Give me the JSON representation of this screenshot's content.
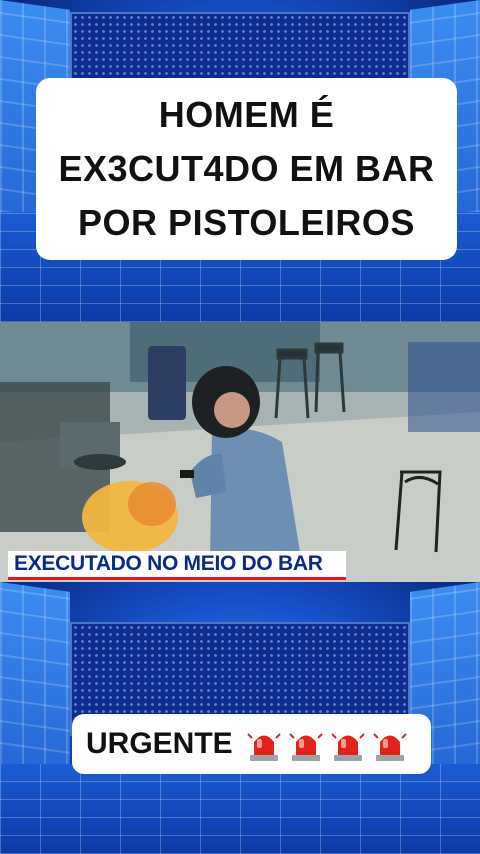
{
  "headline": {
    "lines": [
      "HOMEM É",
      "EX3CUT4DO EM BAR",
      "POR PISTOLEIROS"
    ]
  },
  "video": {
    "lower_third": "EXECUTADO NO MEIO DO BAR"
  },
  "footer": {
    "urgent_label": "URGENTE",
    "siren_icon": "police-siren-emoji",
    "siren_count": 4
  },
  "colors": {
    "studio_blue": "#1650c8",
    "caption_bg": "#ffffff",
    "lower_third_text": "#0a2a8a",
    "lower_third_accent": "#e2141c"
  }
}
